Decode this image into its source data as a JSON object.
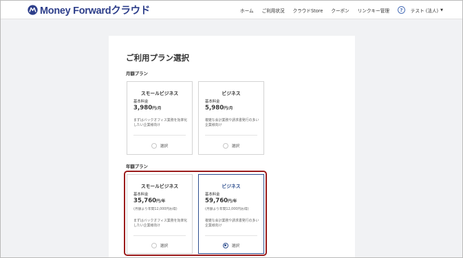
{
  "header": {
    "logo_text": "Money Forward",
    "logo_suffix": "クラウド",
    "nav": [
      "ホーム",
      "ご利用状況",
      "クラウドStore",
      "クーポン",
      "リンクキー管理"
    ],
    "help_symbol": "?",
    "user": "テスト (法人)",
    "caret": "▼"
  },
  "page": {
    "title": "ご利用プラン選択",
    "monthly_label": "月額プラン",
    "annual_label": "年額プラン"
  },
  "monthly_plans": [
    {
      "name": "スモールビジネス",
      "fee_label": "基本料金",
      "price": "3,980",
      "unit": "円/月",
      "desc": "まずはバックオフィス業務を効率化したい企業様向け",
      "select_label": "選択"
    },
    {
      "name": "ビジネス",
      "fee_label": "基本料金",
      "price": "5,980",
      "unit": "円/月",
      "desc": "複雑な会計業務や請求書発行の多い企業様向け",
      "select_label": "選択"
    }
  ],
  "annual_plans": [
    {
      "name": "スモールビジネス",
      "fee_label": "基本料金",
      "price": "35,760",
      "unit": "円/年",
      "discount": "(月額より年間12,000円お得)",
      "desc": "まずはバックオフィス業務を効率化したい企業様向け",
      "select_label": "選択",
      "selected": false
    },
    {
      "name": "ビジネス",
      "fee_label": "基本料金",
      "price": "59,760",
      "unit": "円/年",
      "discount": "(月額より年間12,000円お得)",
      "desc": "複雑な会計業務や請求書発行の多い企業様向け",
      "select_label": "選択",
      "selected": true
    }
  ],
  "colors": {
    "brand": "#2d3e8a",
    "selected_border": "#2d4e8e",
    "highlight": "#9b1b1b"
  }
}
